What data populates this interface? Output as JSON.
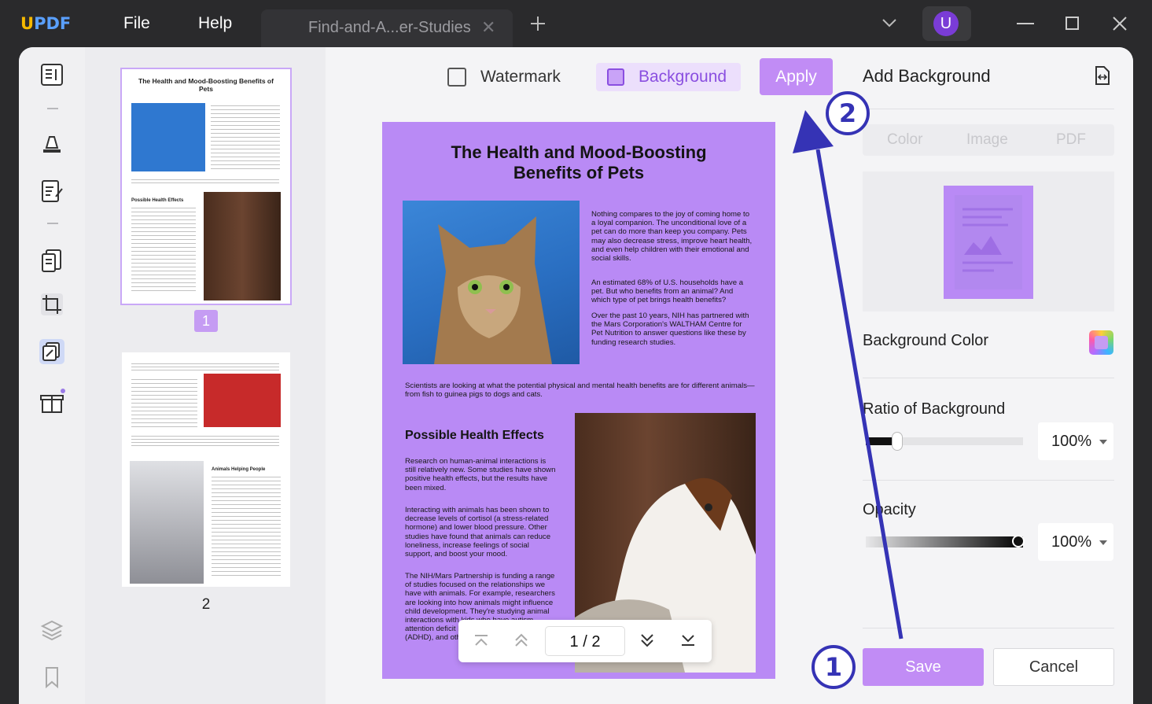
{
  "app": {
    "logo": "UPDF",
    "logo_u": "U",
    "logo_rest": "PDF",
    "menu_file": "File",
    "menu_help": "Help",
    "tab_title": "Find-and-A...er-Studies",
    "avatar_initial": "U"
  },
  "toolbar": {
    "watermark_label": "Watermark",
    "background_label": "Background",
    "apply_label": "Apply"
  },
  "document": {
    "title_line1": "The Health and Mood-Boosting",
    "title_line2": "Benefits of Pets",
    "para1": "Nothing compares to the joy of coming home to a loyal companion. The unconditional love of a pet can do more than keep you company. Pets may also decrease stress, improve heart health, and even help children with their emotional and social skills.",
    "para2": "An estimated 68% of U.S. households have a pet. But who benefits from an animal? And which type of pet brings health benefits?",
    "para3": "Over the past 10 years, NIH has partnered with the Mars Corporation's WALTHAM Centre for Pet Nutrition to answer questions like these by funding research studies.",
    "para4": "Scientists are looking at what the potential physical and mental health benefits are for different animals—from fish to guinea pigs to dogs and cats.",
    "heading": "Possible Health Effects",
    "para5": "Research on human-animal interactions is still relatively new. Some studies have shown positive health effects, but the results have been mixed.",
    "para6": "Interacting with animals has been shown to decrease levels of cortisol (a stress-related hormone) and lower blood pressure. Other studies have found that animals can reduce loneliness, increase feelings of social support, and boost your mood.",
    "para7": "The NIH/Mars Partnership is funding a range of studies focused on the relationships we have with animals. For example, researchers are looking into how animals might influence child development. They're studying animal interactions with kids who have autism, attention deficit hyperactivity disorder (ADHD), and other conditions."
  },
  "thumbnails": {
    "page1_label": "1",
    "page2_label": "2",
    "t1_title": "The Health and Mood-Boosting Benefits of Pets",
    "t1_heading": "Possible Health Effects",
    "t2_heading": "Animals Helping People"
  },
  "pager": {
    "current": "1",
    "separator": "/",
    "total": "2"
  },
  "panel": {
    "title": "Add Background",
    "tab_color": "Color",
    "tab_image": "Image",
    "tab_pdf": "PDF",
    "bg_color_label": "Background Color",
    "ratio_label": "Ratio of Background",
    "ratio_value": "100%",
    "opacity_label": "Opacity",
    "opacity_value": "100%",
    "save_label": "Save",
    "cancel_label": "Cancel",
    "ratio_level": 0.2,
    "opacity_level": 1.0
  },
  "annotations": {
    "step1": "1",
    "step2": "2"
  },
  "colors": {
    "accent": "#c18cf5",
    "page_background": "#b98af5",
    "annotation": "#3533b5"
  },
  "icons": [
    "reader-icon",
    "highlight-icon",
    "edit-pdf-icon",
    "organize-icon",
    "crop-icon",
    "watermark-tool-icon",
    "gift-icon",
    "layers-icon",
    "bookmark-icon",
    "chevron-down-icon",
    "close-icon",
    "plus-icon",
    "minimize-icon",
    "maximize-icon",
    "swap-icon",
    "first-page-icon",
    "prev-page-icon",
    "next-page-icon",
    "last-page-icon"
  ]
}
